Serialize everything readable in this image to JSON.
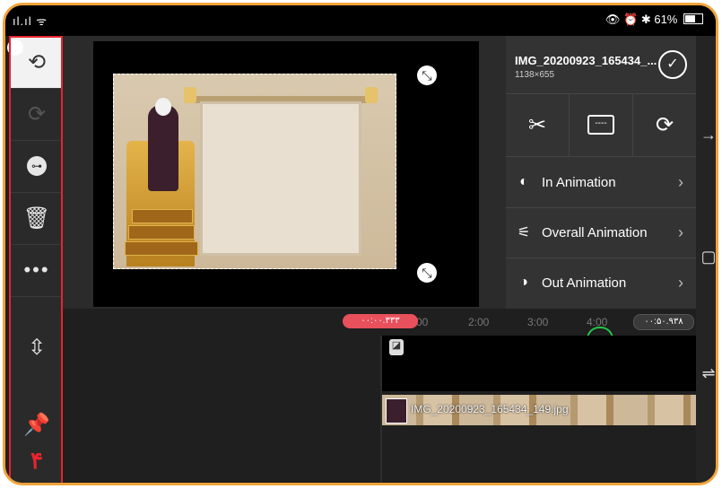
{
  "status": {
    "left_icons": "ıl.ıl ᯤ",
    "right_icons": "👁 ⏰ ✱",
    "battery": "61%"
  },
  "left_toolbar": {
    "annotation_number": "۴"
  },
  "media": {
    "title": "IMG_20200923_165434_...",
    "size": "1138×655"
  },
  "animations": [
    {
      "label": "In Animation"
    },
    {
      "label": "Overall Animation"
    },
    {
      "label": "Out Animation"
    }
  ],
  "timeline": {
    "current_time": "۰۰:۰۰.۳۳۳",
    "total_time": "۰۰:۵۰.۹۳۸",
    "ticks": [
      "2:00",
      "3:00",
      "4:00"
    ],
    "clip_label": "IMG_20200923_165434_149.jpg"
  },
  "colors": {
    "accent_highlight": "#e8242d",
    "frame_border": "#f0a43a",
    "playhead_badge": "#e8505b",
    "playhead_arc": "#25c44a"
  }
}
